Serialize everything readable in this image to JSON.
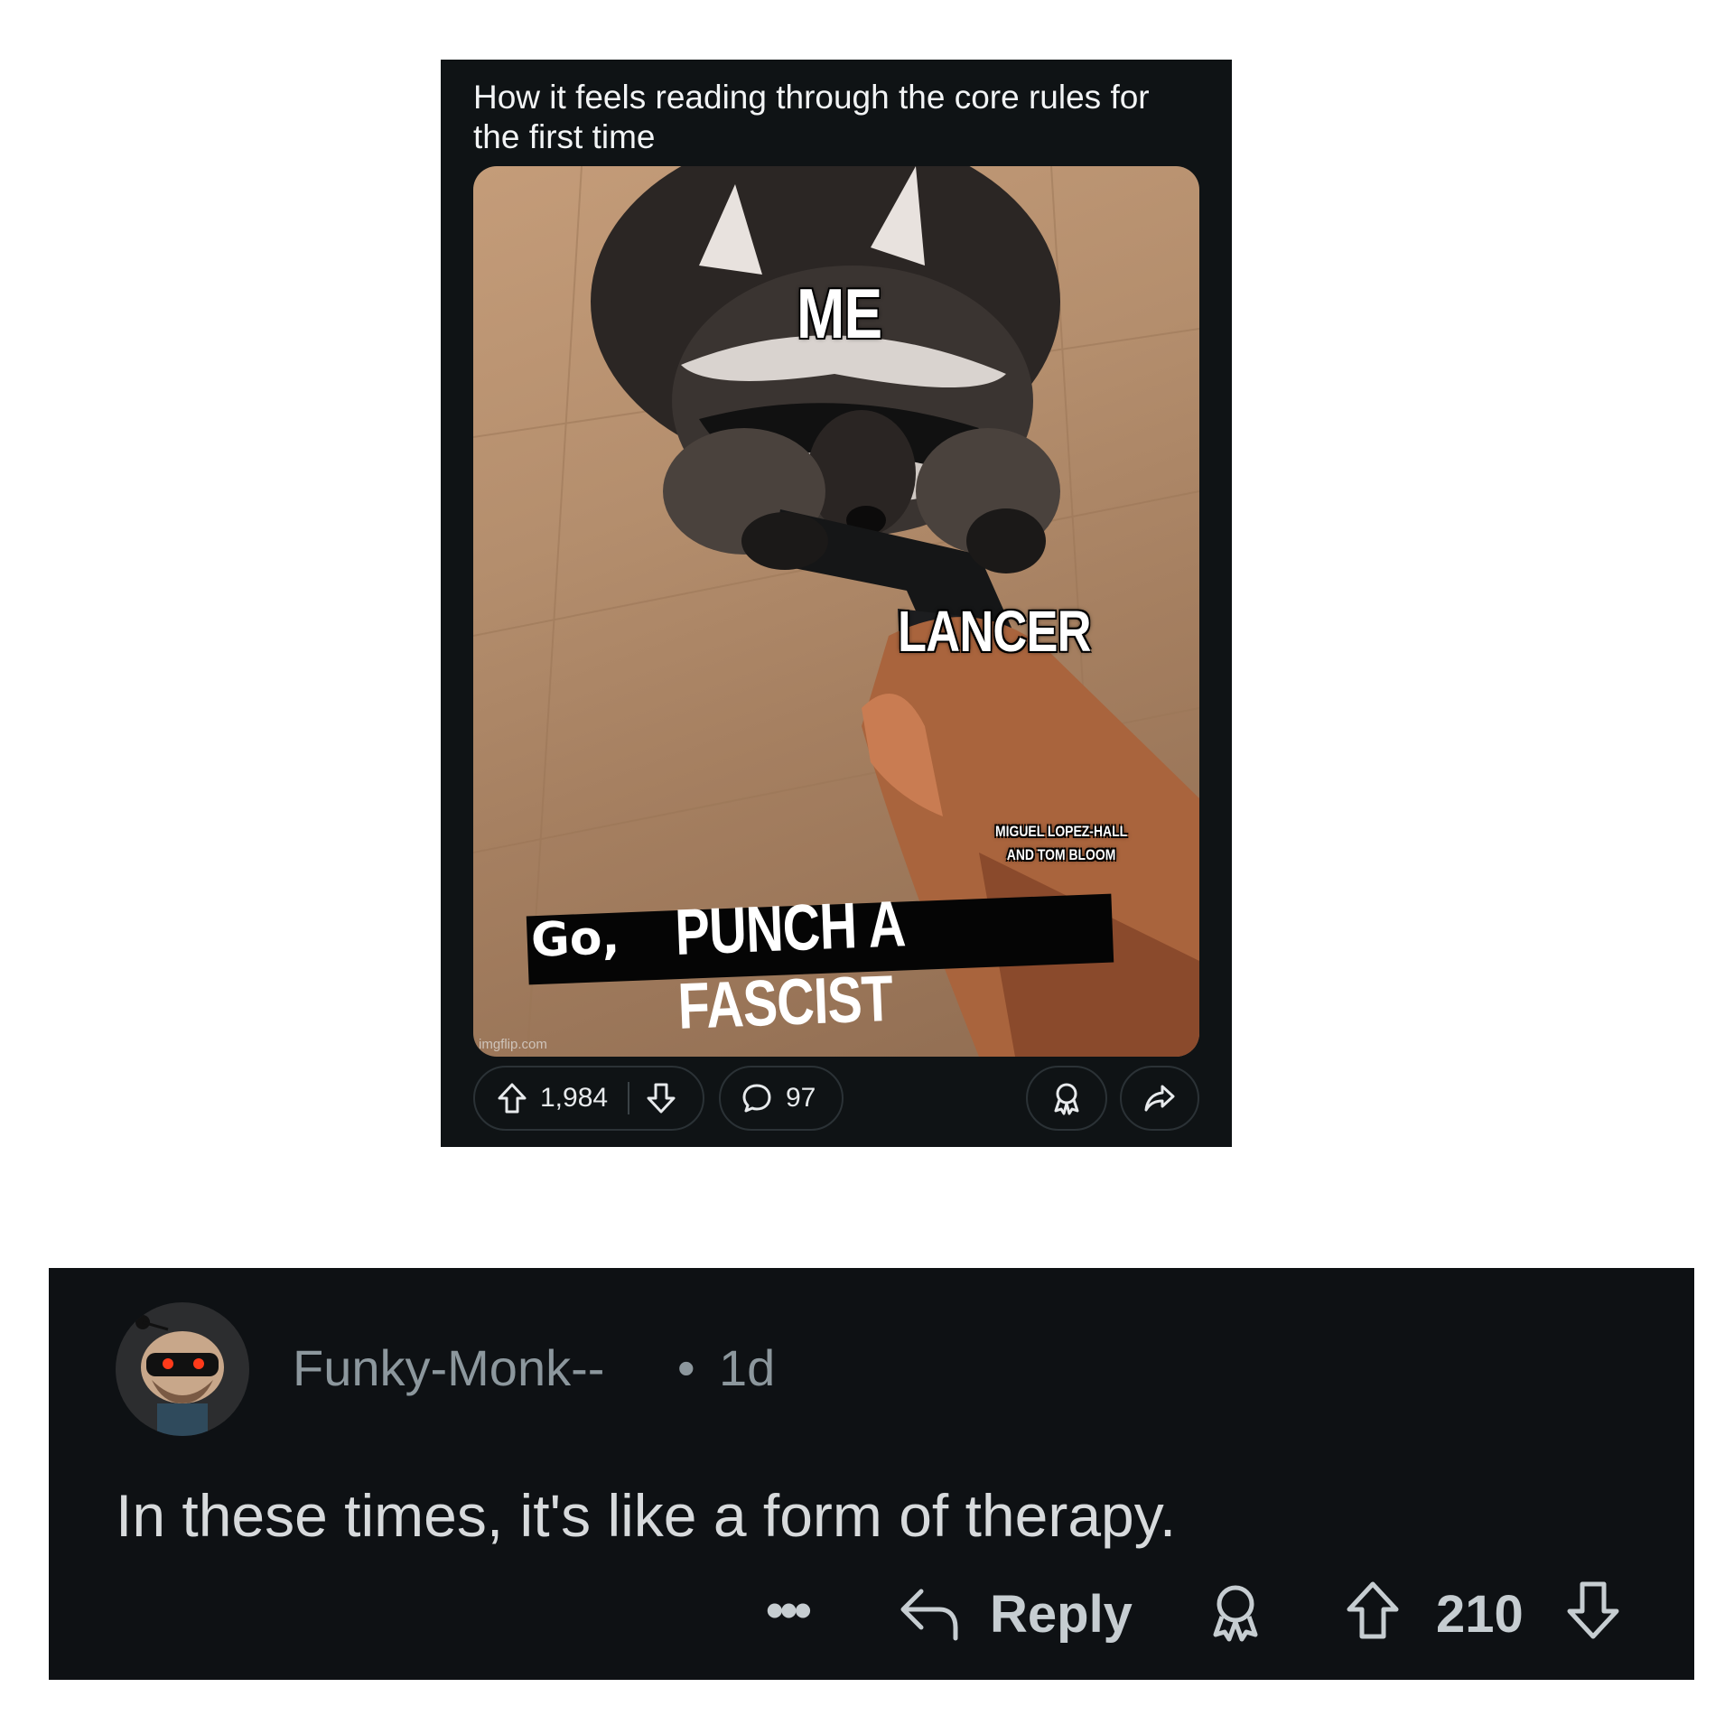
{
  "post": {
    "title": "How it feels reading through the core rules for the first time",
    "meme": {
      "captions": {
        "me": "ME",
        "lancer": "LANCER",
        "credit_line1": "MIGUEL LOPEZ-HALL",
        "credit_line2": "AND TOM BLOOM",
        "go": "Go,",
        "punch": "PUNCH A FASCIST"
      },
      "watermark": "imgflip.com"
    },
    "actions": {
      "upvotes": "1,984",
      "comments": "97",
      "icons": [
        "upvote-icon",
        "downvote-icon",
        "comment-icon",
        "award-icon",
        "share-icon"
      ]
    }
  },
  "comment": {
    "author": "Funky-Monk--",
    "separator": "•",
    "age": "1d",
    "body": "In these times, it's like a form of therapy.",
    "actions": {
      "more": "•••",
      "reply": "Reply",
      "score": "210",
      "icons": [
        "more-icon",
        "reply-icon",
        "award-icon",
        "upvote-icon",
        "downvote-icon"
      ]
    }
  },
  "colors": {
    "card_bg": "#0f1315",
    "comment_bg": "#0e1114",
    "muted_text": "#8c979d",
    "body_text": "#d7dadc"
  }
}
